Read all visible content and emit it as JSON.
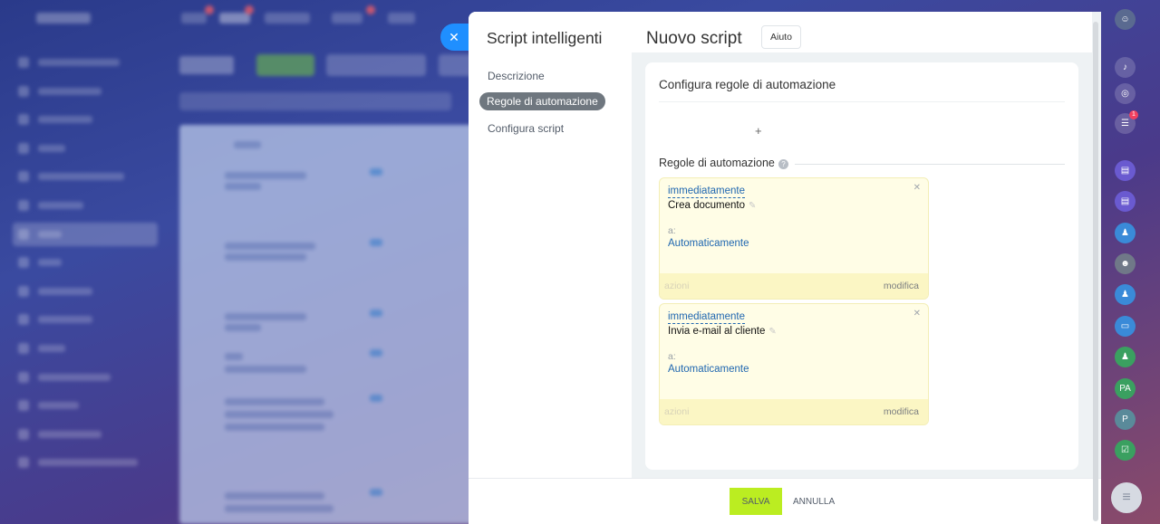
{
  "panel": {
    "title": "Script intelligenti",
    "menu": [
      {
        "label": "Descrizione",
        "active": false
      },
      {
        "label": "Regole di automazione",
        "active": true
      },
      {
        "label": "Configura script",
        "active": false
      }
    ]
  },
  "main": {
    "title": "Nuovo script",
    "help_label": "Aiuto",
    "section_title": "Configura regole di automazione",
    "add_symbol": "+",
    "rules_label": "Regole di automazione",
    "rules": [
      {
        "timing": "immediatamente",
        "name": "Crea documento",
        "to_label": "a:",
        "to_value": "Automaticamente",
        "actions_label": "azioni",
        "edit_label": "modifica"
      },
      {
        "timing": "immediatamente",
        "name": "Invia e-mail al cliente",
        "to_label": "a:",
        "to_value": "Automaticamente",
        "actions_label": "azioni",
        "edit_label": "modifica"
      }
    ]
  },
  "footer": {
    "save_label": "SALVA",
    "cancel_label": "ANNULLA"
  },
  "rail": {
    "counter_badge": "1",
    "avatar_initials": [
      "PA",
      "P"
    ]
  },
  "colors": {
    "accent": "#1f8fff",
    "save": "#bbed21",
    "rule_bg": "#fffde6",
    "link": "#2067b0"
  },
  "icons": {
    "close": "close-icon",
    "pencil": "pencil-icon",
    "help": "question-icon",
    "remove": "remove-icon"
  }
}
